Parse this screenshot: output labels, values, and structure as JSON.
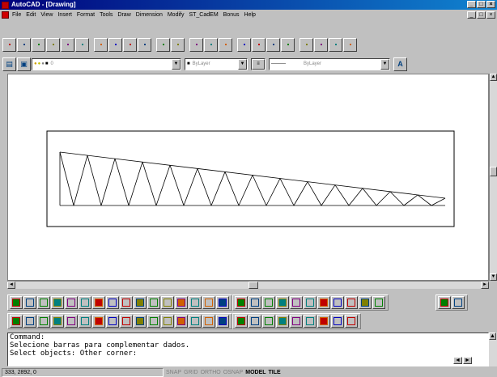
{
  "window": {
    "title": "AutoCAD - [Drawing]"
  },
  "menu": [
    "File",
    "Edit",
    "View",
    "Insert",
    "Format",
    "Tools",
    "Draw",
    "Dimension",
    "Modify",
    "ST_CadEM",
    "Bonus",
    "Help"
  ],
  "window_buttons": {
    "min": "_",
    "max": "□",
    "close": "×"
  },
  "layer_toolbar": {
    "layer_value": "0",
    "color_value": "ByLayer",
    "linetype_value": "ByLayer",
    "lineweight_value": "ByLayer"
  },
  "command_lines": [
    "Command:",
    "Selecione barras para complementar dados.",
    "Select objects: Other corner:"
  ],
  "status": {
    "coords": "333, 2892, 0",
    "modes": [
      {
        "label": "SNAP",
        "on": false
      },
      {
        "label": "GRID",
        "on": false
      },
      {
        "label": "ORTHO",
        "on": false
      },
      {
        "label": "OSNAP",
        "on": false
      },
      {
        "label": "MODEL",
        "on": true
      },
      {
        "label": "TILE",
        "on": true
      }
    ]
  },
  "colors": {
    "title_start": "#00007b",
    "title_end": "#1084d0",
    "face": "#c0c0c0"
  },
  "icons": {
    "standard": [
      "new-icon",
      "open-icon",
      "save-icon",
      "print-icon",
      "preview-icon",
      "spell-icon",
      "cut-icon",
      "copy-icon",
      "paste-icon",
      "matchprop-icon",
      "undo-icon",
      "redo-icon",
      "launch-icon",
      "tracking-icon",
      "ucs-icon",
      "inquiry-icon",
      "redraw-icon",
      "aerial-icon",
      "pan-icon",
      "zoom-realtime-icon",
      "zoom-window-icon",
      "zoom-previous-icon",
      "help-icon"
    ],
    "custom1": [
      "truss-icon",
      "beam-icon",
      "column-icon",
      "frame-icon",
      "grid-icon",
      "node-icon",
      "support-icon",
      "load-icon",
      "section-icon",
      "member-icon",
      "panel-icon",
      "circle-icon",
      "bolt-icon",
      "weld-icon",
      "fv-icon",
      "select-icon",
      "dots-icon",
      "hatch-icon",
      "joint-icon",
      "plate-icon",
      "brace-icon",
      "angle-icon",
      "pencil-icon",
      "triangle-icon",
      "cross-icon",
      "ring-icon",
      "list-icon",
      "flag-icon",
      "cube-icon"
    ],
    "custom2": [
      "c-profile-icon",
      "i-profile-icon",
      "box-profile-icon",
      "channel-icon",
      "double-channel-icon",
      "angle-profile-icon",
      "tee-icon",
      "hat-icon",
      "x-brace-icon",
      "z-profile-icon",
      "c-section-icon",
      "extrude-icon",
      "f-section-icon",
      "i-section-icon",
      "grid2-icon",
      "flag2-icon",
      "pen-icon",
      "brush-icon",
      "tree-icon",
      "chart-icon",
      "table-icon",
      "info-icon",
      "red-square-icon",
      "blue-square-icon",
      "report-icon"
    ]
  }
}
